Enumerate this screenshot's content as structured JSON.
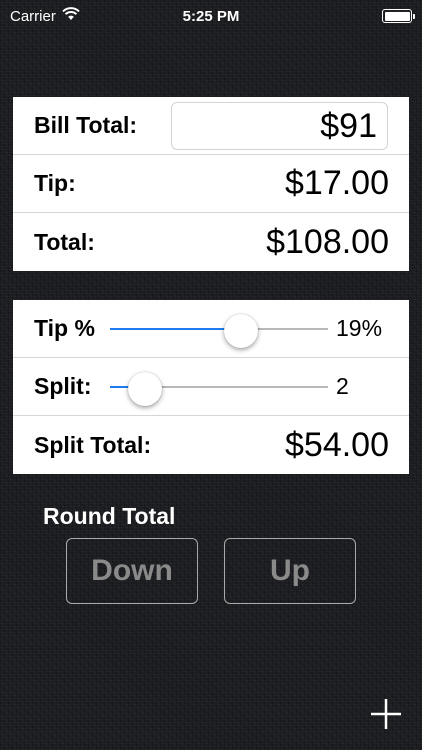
{
  "status_bar": {
    "carrier": "Carrier",
    "time": "5:25 PM"
  },
  "bill": {
    "bill_total_label": "Bill Total:",
    "bill_total_value": "$91",
    "tip_label": "Tip:",
    "tip_value": "$17.00",
    "total_label": "Total:",
    "total_value": "$108.00"
  },
  "split": {
    "tip_percent_label": "Tip %",
    "tip_percent_value": "19%",
    "tip_percent_fraction": 0.6,
    "split_label": "Split:",
    "split_value": "2",
    "split_fraction": 0.16,
    "split_total_label": "Split Total:",
    "split_total_value": "$54.00"
  },
  "round": {
    "title": "Round Total",
    "down_label": "Down",
    "up_label": "Up"
  },
  "colors": {
    "accent": "#1e7cf0",
    "background": "#1c1d21"
  },
  "icons": [
    "wifi-icon",
    "battery-icon",
    "plus-icon"
  ]
}
